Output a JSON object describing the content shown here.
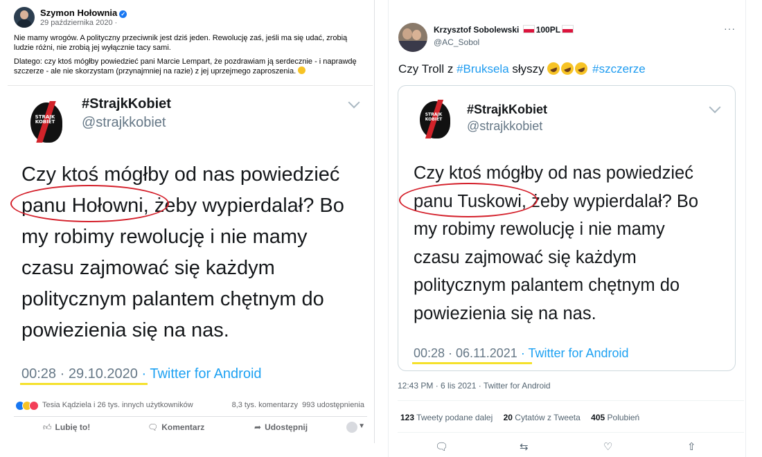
{
  "facebook": {
    "author": "Szymon Hołownia",
    "date": "29 października 2020 ·",
    "text1": "Nie mamy wrogów. A polityczny przeciwnik jest dziś jeden. Rewolucję zaś, jeśli ma się udać, zrobią ludzie różni, nie zrobią jej wyłącznie tacy sami.",
    "text2": "Dlatego: czy ktoś mógłby powiedzieć pani Marcie Lempart, że pozdrawiam ją serdecznie - i naprawdę szczerze - ale nie skorzystam (przynajmniej na razie) z jej uprzejmego zaproszenia.",
    "reactions_who": "Tesia Kądziela i 26 tys. innych użytkowników",
    "comments": "8,3 tys. komentarzy",
    "shares": "993 udostępnienia",
    "actions": {
      "like": "Lubię to!",
      "comment": "Komentarz",
      "share": "Udostępnij"
    }
  },
  "embedded_left": {
    "logo_text": "STRAJK KOBIET",
    "name": "#StrajkKobiet",
    "handle": "@strajkkobiet",
    "lines": [
      "Czy ktoś mógłby od nas powiedzieć",
      "panu Hołowni, żeby wypierdalał? Bo",
      "my robimy rewolucję i nie mamy",
      "czasu zajmować się każdym",
      "politycznym palantem chętnym do",
      "powiezienia się na nas."
    ],
    "timestamp": "00:28 · 29.10.2020",
    "source": "· Twitter for Android"
  },
  "twitter": {
    "author": "Krzysztof Sobolewski",
    "author_suffix": "100PL",
    "handle": "@AC_Sobol",
    "more": "···",
    "text_a": "Czy Troll z ",
    "hashtag1": "#Bruksela",
    "text_b": " słyszy ",
    "hashtag2": "#szczerze",
    "time": "12:43 PM · 6 lis 2021 · Twitter for Android",
    "retweets_num": "123",
    "retweets_label": "Tweety podane dalej",
    "quotes_num": "20",
    "quotes_label": "Cytatów z Tweeta",
    "likes_num": "405",
    "likes_label": "Polubień"
  },
  "embedded_right": {
    "logo_text": "STRAJK KOBIET",
    "name": "#StrajkKobiet",
    "handle": "@strajkkobiet",
    "lines": [
      "Czy ktoś mógłby od nas powiedzieć",
      "panu Tuskowi, żeby wypierdalał? Bo",
      "my robimy rewolucję i nie mamy",
      "czasu zajmować się każdym",
      "politycznym palantem chętnym do",
      "powiezienia się na nas."
    ],
    "timestamp": "00:28 · 06.11.2021",
    "source": "· Twitter for Android"
  },
  "colors": {
    "facebook_blue": "#1877f2",
    "twitter_blue": "#1d9bf0",
    "circle_red": "#d41f2a",
    "underline_yellow": "#f5e12a"
  },
  "icons": [
    "verified-icon",
    "like-icon",
    "comment-icon",
    "share-icon",
    "reply-icon",
    "retweet-icon",
    "heart-icon",
    "upload-icon",
    "chevron-down-icon",
    "more-icon"
  ]
}
